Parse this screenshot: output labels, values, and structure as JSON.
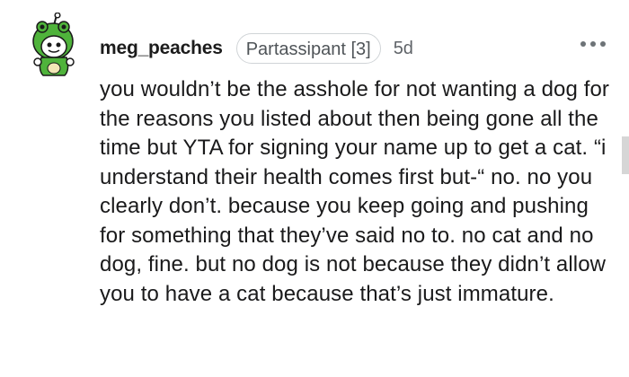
{
  "comment": {
    "author": "meg_peaches",
    "flair": "Partassipant [3]",
    "age": "5d",
    "body": "you wouldn’t be the asshole for not wanting a dog for the reasons you listed about then being gone all the time but YTA for signing your name up to get a cat. “i understand their health comes first but-“ no. no you clearly don’t. because you keep going and pushing for something that they’ve said no to. no cat and no dog, fine. but no dog is not because they didn’t allow you to have a cat because that’s just immature."
  },
  "icons": {
    "avatar": "snoo-avatar-green-frog-hood",
    "more": "more-horizontal-icon"
  },
  "colors": {
    "text": "#1a1a1b",
    "muted": "#5f6368",
    "flair_border": "#d0d4d7",
    "avatar_green": "#4fb33b"
  }
}
